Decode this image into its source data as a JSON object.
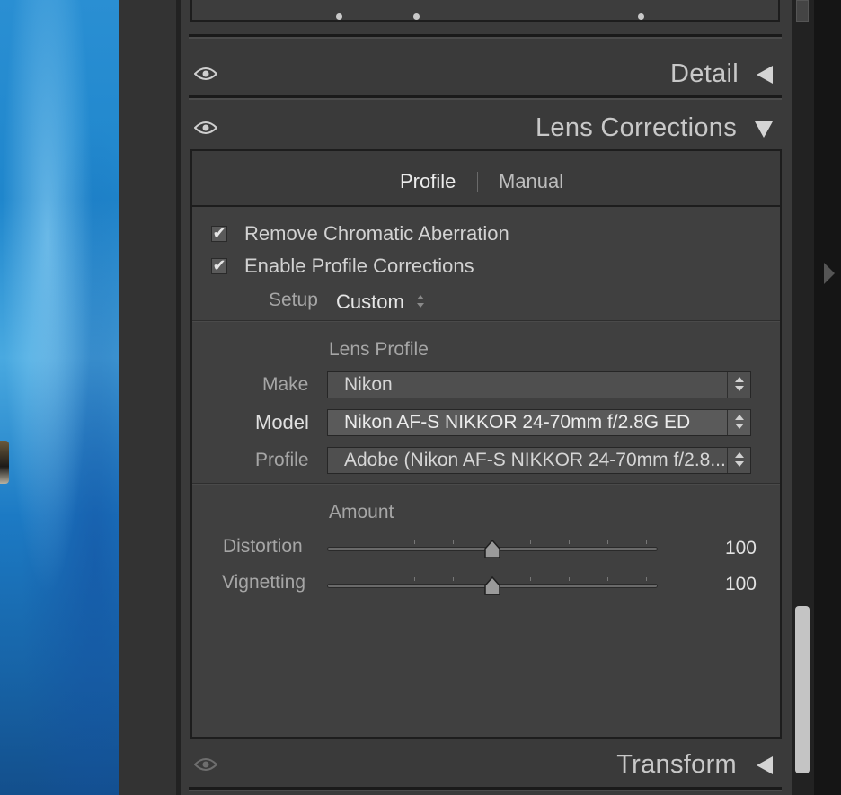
{
  "sections": {
    "detail": {
      "title": "Detail"
    },
    "lens_corrections": {
      "title": "Lens Corrections"
    },
    "transform": {
      "title": "Transform"
    }
  },
  "tabs": [
    {
      "label": "Profile",
      "active": true
    },
    {
      "label": "Manual",
      "active": false
    }
  ],
  "checks": {
    "chromatic": {
      "label": "Remove Chromatic Aberration",
      "checked": true
    },
    "profile": {
      "label": "Enable Profile Corrections",
      "checked": true
    }
  },
  "setup": {
    "label": "Setup",
    "value": "Custom"
  },
  "lens_profile": {
    "heading": "Lens Profile",
    "make": {
      "label": "Make",
      "value": "Nikon"
    },
    "model": {
      "label": "Model",
      "value": "Nikon AF-S NIKKOR 24-70mm f/2.8G ED"
    },
    "profile": {
      "label": "Profile",
      "value": "Adobe (Nikon AF-S NIKKOR 24-70mm f/2.8..."
    }
  },
  "amount": {
    "heading": "Amount",
    "distortion": {
      "label": "Distortion",
      "value": "100"
    },
    "vignetting": {
      "label": "Vignetting",
      "value": "100"
    }
  },
  "icons": {
    "eye": "eye-icon",
    "collapse": "triangle-left-icon",
    "expand": "triangle-down-icon",
    "check": "✔"
  },
  "colors": {
    "panel": "#3a3a3a",
    "text": "#cfcfcf",
    "photo": "#2a8fd3"
  }
}
